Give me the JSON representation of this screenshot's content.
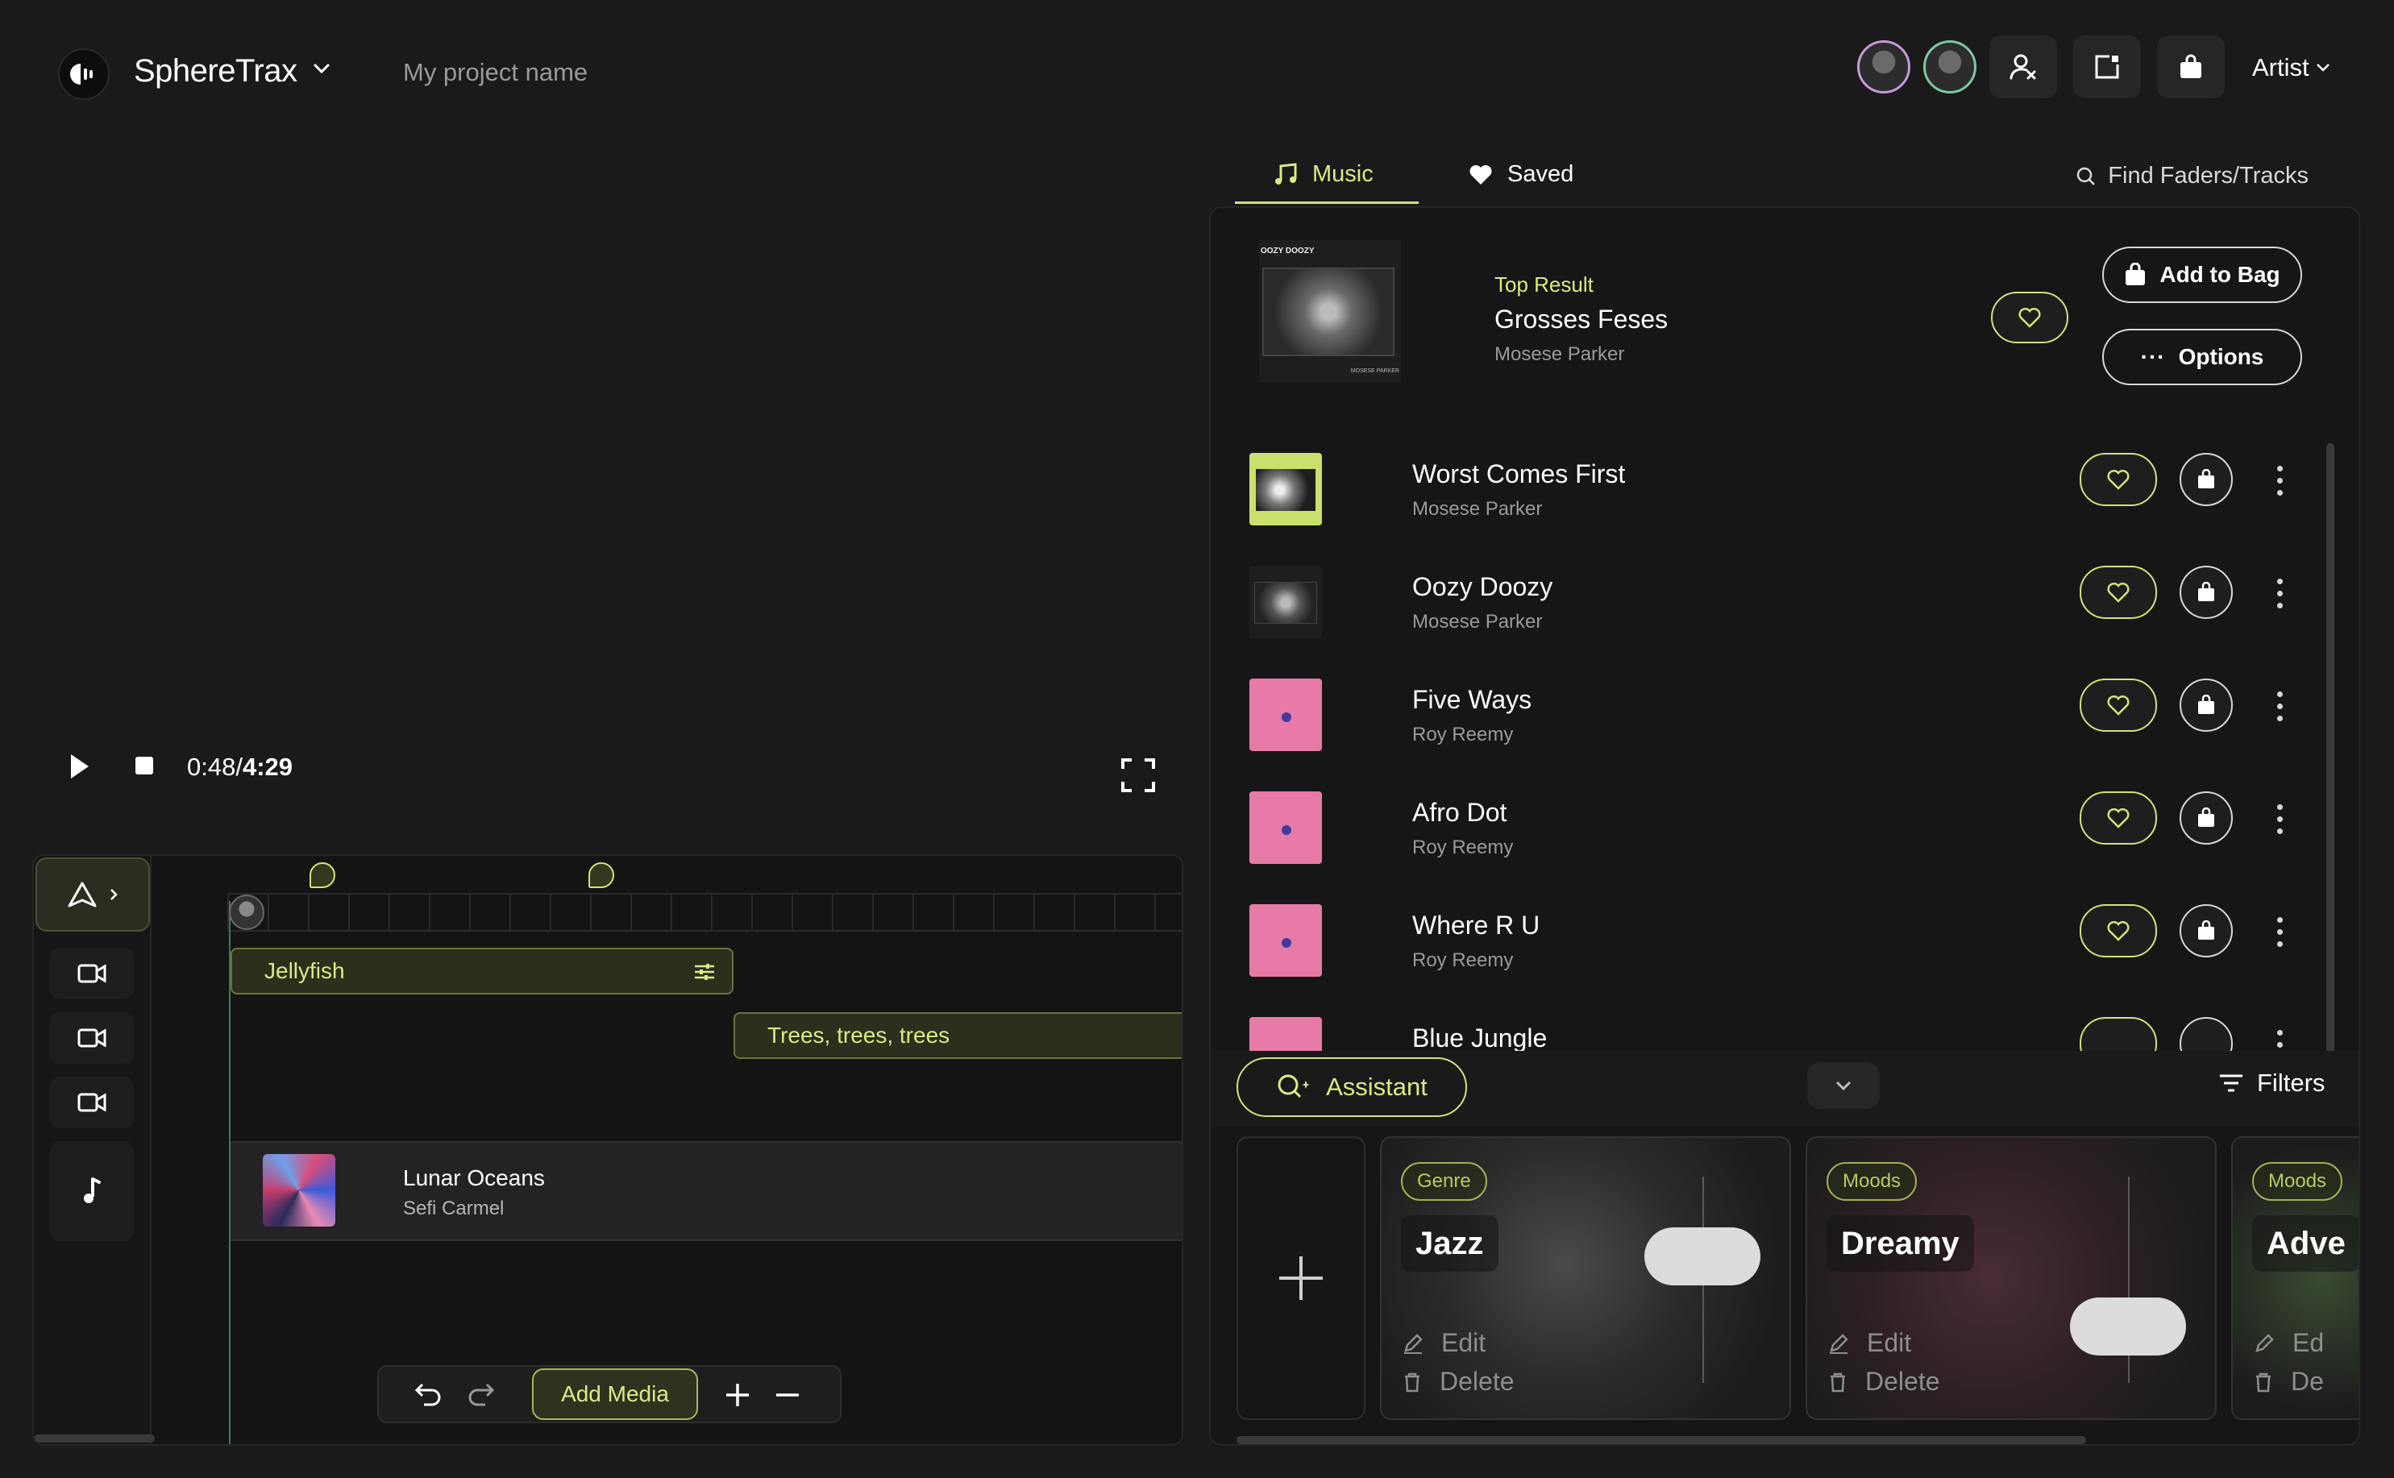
{
  "header": {
    "app_name": "SphereTrax",
    "project_name": "My project name",
    "artist_label": "Artist"
  },
  "player": {
    "current_time": "0:48",
    "total_time": "4:29"
  },
  "timeline": {
    "clips": [
      {
        "label": "Jellyfish"
      },
      {
        "label": "Trees, trees, trees"
      }
    ],
    "audio": {
      "title": "Lunar Oceans",
      "artist": "Sefi Carmel"
    },
    "add_media_label": "Add Media"
  },
  "panel": {
    "tabs": [
      {
        "label": "Music",
        "icon": "music-note-icon"
      },
      {
        "label": "Saved",
        "icon": "heart-icon"
      }
    ],
    "find_label": "Find Faders/Tracks",
    "top_result": {
      "section_label": "Top Result",
      "title": "Grosses Feses",
      "artist": "Mosese Parker",
      "add_to_bag_label": "Add to Bag",
      "options_label": "Options",
      "art_text": "OOZY DOOZY",
      "art_subtext": "MOSESE PARKER"
    },
    "tracks": [
      {
        "title": "Worst Comes First",
        "artist": "Mosese Parker",
        "art": "green"
      },
      {
        "title": "Oozy Doozy",
        "artist": "Mosese Parker",
        "art": "gray"
      },
      {
        "title": "Five Ways",
        "artist": "Roy Reemy",
        "art": "pink"
      },
      {
        "title": "Afro Dot",
        "artist": "Roy Reemy",
        "art": "pink"
      },
      {
        "title": "Where R U",
        "artist": "Roy Reemy",
        "art": "pink"
      },
      {
        "title": "Blue Jungle",
        "artist": "",
        "art": "pink"
      }
    ],
    "assistant_label": "Assistant",
    "filters_label": "Filters",
    "faders": [
      {
        "tag": "Genre",
        "name": "Jazz",
        "edit": "Edit",
        "delete": "Delete",
        "level": 0.65
      },
      {
        "tag": "Moods",
        "name": "Dreamy",
        "edit": "Edit",
        "delete": "Delete",
        "level": 0.2
      },
      {
        "tag": "Moods",
        "name": "Adve",
        "edit": "Ed",
        "delete": "De"
      }
    ]
  },
  "colors": {
    "accent": "#cfe57b",
    "background": "#1a1a1a",
    "panel": "#161616"
  }
}
